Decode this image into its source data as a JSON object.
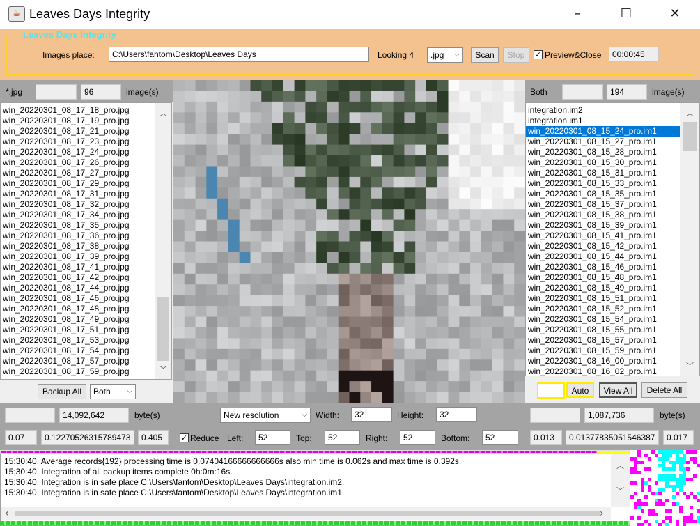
{
  "window": {
    "title": "Leaves Days Integrity",
    "icon": "java-coffee-icon",
    "minimize": "–",
    "maximize": "☐",
    "close": "✕"
  },
  "top_panel": {
    "group_title": "Leaves Days Integrity",
    "images_place_label": "Images place:",
    "images_place_value": "C:\\Users\\fantom\\Desktop\\Leaves Days",
    "looking_label": "Looking 4",
    "extension_selected": ".jpg",
    "scan_label": "Scan",
    "stop_label": "Stop",
    "preview_close_label": "Preview&Close",
    "preview_close_checked": true,
    "timer": "00:00:45"
  },
  "left": {
    "filter_label": "*.jpg",
    "filter_value": "",
    "count": "96",
    "count_unit": "image(s)",
    "files": [
      "win_20220301_08_17_18_pro.jpg",
      "win_20220301_08_17_19_pro.jpg",
      "win_20220301_08_17_21_pro.jpg",
      "win_20220301_08_17_23_pro.jpg",
      "win_20220301_08_17_24_pro.jpg",
      "win_20220301_08_17_26_pro.jpg",
      "win_20220301_08_17_27_pro.jpg",
      "win_20220301_08_17_29_pro.jpg",
      "win_20220301_08_17_31_pro.jpg",
      "win_20220301_08_17_32_pro.jpg",
      "win_20220301_08_17_34_pro.jpg",
      "win_20220301_08_17_35_pro.jpg",
      "win_20220301_08_17_36_pro.jpg",
      "win_20220301_08_17_38_pro.jpg",
      "win_20220301_08_17_39_pro.jpg",
      "win_20220301_08_17_41_pro.jpg",
      "win_20220301_08_17_42_pro.jpg",
      "win_20220301_08_17_44_pro.jpg",
      "win_20220301_08_17_46_pro.jpg",
      "win_20220301_08_17_48_pro.jpg",
      "win_20220301_08_17_49_pro.jpg",
      "win_20220301_08_17_51_pro.jpg",
      "win_20220301_08_17_53_pro.jpg",
      "win_20220301_08_17_54_pro.jpg",
      "win_20220301_08_17_57_pro.jpg",
      "win_20220301_08_17_59_pro.jpg"
    ],
    "backup_all_label": "Backup All",
    "backup_mode": "Both",
    "bytes_empty": "",
    "bytes_value": "14,092,642",
    "bytes_unit": "byte(s)",
    "stat1": "0.07",
    "stat2": "0.12270526315789473",
    "stat3": "0.405"
  },
  "center": {
    "resolution_selected": "New resolution",
    "width_label": "Width:",
    "width_value": "32",
    "height_label": "Height:",
    "height_value": "32",
    "reduce_label": "Reduce",
    "reduce_checked": true,
    "left_label": "Left:",
    "left_value": "52",
    "top_label": "Top:",
    "top_value": "52",
    "right_label": "Right:",
    "right_value": "52",
    "bottom_label": "Bottom:",
    "bottom_value": "52"
  },
  "right": {
    "filter_label": "Both",
    "filter_value": "",
    "count": "194",
    "count_unit": "image(s)",
    "files": [
      "integration.im2",
      "integration.im1",
      "win_20220301_08_15_24_pro.im1",
      "win_20220301_08_15_27_pro.im1",
      "win_20220301_08_15_28_pro.im1",
      "win_20220301_08_15_30_pro.im1",
      "win_20220301_08_15_31_pro.im1",
      "win_20220301_08_15_33_pro.im1",
      "win_20220301_08_15_35_pro.im1",
      "win_20220301_08_15_37_pro.im1",
      "win_20220301_08_15_38_pro.im1",
      "win_20220301_08_15_39_pro.im1",
      "win_20220301_08_15_41_pro.im1",
      "win_20220301_08_15_42_pro.im1",
      "win_20220301_08_15_44_pro.im1",
      "win_20220301_08_15_46_pro.im1",
      "win_20220301_08_15_48_pro.im1",
      "win_20220301_08_15_49_pro.im1",
      "win_20220301_08_15_51_pro.im1",
      "win_20220301_08_15_52_pro.im1",
      "win_20220301_08_15_54_pro.im1",
      "win_20220301_08_15_55_pro.im1",
      "win_20220301_08_15_57_pro.im1",
      "win_20220301_08_15_59_pro.im1",
      "win_20220301_08_16_00_pro.im1",
      "win_20220301_08_16_02_pro.im1"
    ],
    "selected_index": 2,
    "auto_field": "",
    "auto_label": "Auto",
    "view_all_label": "View All",
    "delete_all_label": "Delete All",
    "bytes_empty": "",
    "bytes_value": "1,087,736",
    "bytes_unit": "byte(s)",
    "stat1": "0.013",
    "stat2": "0.01377835051546387",
    "stat3": "0.017"
  },
  "log": {
    "lines": [
      "15:30:40, Average records{192} processing time is 0.07404166666666666s also min time is 0.062s and max time is 0.392s.",
      "15:30:40, Integration of all backup items complete 0h:0m:16s.",
      "15:30:40, Integration is in safe place C:\\Users\\fantom\\Desktop\\Leaves Days\\integration.im2.",
      "15:30:40, Integration is in safe place C:\\Users\\fantom\\Desktop\\Leaves Days\\integration.im1."
    ]
  },
  "colors": {
    "orange_panel": "#f4c28f",
    "group_border": "#ffd02c",
    "group_title": "#54e6ee",
    "selection": "#0078d7",
    "progress_magenta": "#e000e0",
    "progress_yellow": "#ffff00",
    "progress_green": "#40e040"
  }
}
